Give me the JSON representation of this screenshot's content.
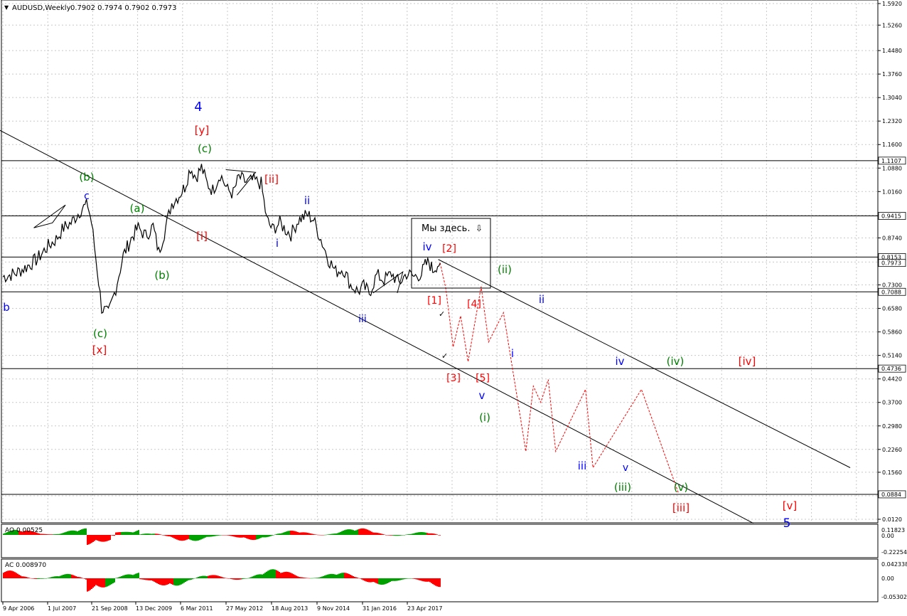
{
  "header": {
    "menu_icon": "triangle-down-icon",
    "symbol": "AUDUSD,Weekly",
    "ohlc": "0.7902 0.7974 0.7902 0.7973"
  },
  "callout": {
    "text": "Мы здесь.",
    "arrow_icon": "arrow-down-outline-icon"
  },
  "colors": {
    "grid": "#c8c8c8",
    "price": "#000000",
    "forecast": "#ff0000",
    "label_blue": "#0000ff",
    "label_red": "#ff0000",
    "label_green": "#008000",
    "ao_up": "#00a000",
    "ao_down": "#ff0000",
    "price_box_bg": "#ffffff",
    "current_price_bg": "#ffffff"
  },
  "chart_data": {
    "type": "line",
    "symbol": "AUDUSD",
    "timeframe": "Weekly",
    "x_ticks": [
      "9 Apr 2006",
      "1 Jul 2007",
      "21 Sep 2008",
      "13 Dec 2009",
      "6 Mar 2011",
      "27 May 2012",
      "18 Aug 2013",
      "9 Nov 2014",
      "31 Jan 2016",
      "23 Apr 2017"
    ],
    "y_ticks": [
      "1.5920",
      "1.5260",
      "1.4480",
      "1.3760",
      "1.3040",
      "1.2320",
      "1.1600",
      "1.0880",
      "1.0160",
      "0.9440",
      "0.8740",
      "0.8000",
      "0.7300",
      "0.6580",
      "0.5860",
      "0.5140",
      "0.4420",
      "0.3700",
      "0.2980",
      "0.2260",
      "0.1560",
      "0.0840",
      "0.0120"
    ],
    "ylim": [
      0.012,
      1.592
    ],
    "horizontal_levels": [
      "1.1107",
      "0.9415",
      "0.8153",
      "0.7088",
      "0.4736",
      "0.0884"
    ],
    "current_price": "0.7973",
    "price_series_weekly_close_sampled": [
      [
        2006.27,
        0.755
      ],
      [
        2006.6,
        0.765
      ],
      [
        2006.9,
        0.785
      ],
      [
        2007.2,
        0.81
      ],
      [
        2007.45,
        0.845
      ],
      [
        2007.7,
        0.87
      ],
      [
        2007.9,
        0.905
      ],
      [
        2008.1,
        0.92
      ],
      [
        2008.4,
        0.965
      ],
      [
        2008.55,
        0.975
      ],
      [
        2008.65,
        0.92
      ],
      [
        2008.8,
        0.78
      ],
      [
        2008.92,
        0.66
      ],
      [
        2009.1,
        0.64
      ],
      [
        2009.3,
        0.72
      ],
      [
        2009.5,
        0.82
      ],
      [
        2009.75,
        0.88
      ],
      [
        2009.9,
        0.905
      ],
      [
        2010.1,
        0.88
      ],
      [
        2010.3,
        0.91
      ],
      [
        2010.45,
        0.83
      ],
      [
        2010.6,
        0.89
      ],
      [
        2010.8,
        0.98
      ],
      [
        2011.0,
        1.005
      ],
      [
        2011.15,
        1.03
      ],
      [
        2011.3,
        1.09
      ],
      [
        2011.45,
        1.06
      ],
      [
        2011.6,
        1.09
      ],
      [
        2011.75,
        1.04
      ],
      [
        2011.9,
        1.02
      ],
      [
        2012.1,
        1.07
      ],
      [
        2012.3,
        1.02
      ],
      [
        2012.45,
        1.01
      ],
      [
        2012.6,
        1.06
      ],
      [
        2012.8,
        1.045
      ],
      [
        2013.0,
        1.05
      ],
      [
        2013.2,
        1.04
      ],
      [
        2013.35,
        0.93
      ],
      [
        2013.5,
        0.9
      ],
      [
        2013.7,
        0.92
      ],
      [
        2013.85,
        0.9
      ],
      [
        2014.0,
        0.885
      ],
      [
        2014.2,
        0.93
      ],
      [
        2014.45,
        0.945
      ],
      [
        2014.6,
        0.93
      ],
      [
        2014.8,
        0.87
      ],
      [
        2015.0,
        0.81
      ],
      [
        2015.2,
        0.77
      ],
      [
        2015.4,
        0.78
      ],
      [
        2015.6,
        0.73
      ],
      [
        2015.8,
        0.71
      ],
      [
        2015.95,
        0.725
      ],
      [
        2016.1,
        0.705
      ],
      [
        2016.3,
        0.76
      ],
      [
        2016.5,
        0.745
      ],
      [
        2016.7,
        0.765
      ],
      [
        2016.9,
        0.735
      ],
      [
        2017.1,
        0.765
      ],
      [
        2017.3,
        0.755
      ],
      [
        2017.5,
        0.765
      ],
      [
        2017.6,
        0.79
      ],
      [
        2017.7,
        0.8
      ],
      [
        2017.8,
        0.775
      ],
      [
        2017.9,
        0.79
      ],
      [
        2018.0,
        0.7973
      ]
    ],
    "forecast_path_red_dashed": [
      [
        2018.0,
        0.7973
      ],
      [
        2018.15,
        0.72
      ],
      [
        2018.35,
        0.54
      ],
      [
        2018.55,
        0.635
      ],
      [
        2018.75,
        0.495
      ],
      [
        2019.1,
        0.725
      ],
      [
        2019.3,
        0.555
      ],
      [
        2019.7,
        0.645
      ],
      [
        2020.3,
        0.22
      ],
      [
        2020.5,
        0.42
      ],
      [
        2020.7,
        0.37
      ],
      [
        2020.9,
        0.44
      ],
      [
        2021.1,
        0.22
      ],
      [
        2021.9,
        0.41
      ],
      [
        2022.1,
        0.17
      ],
      [
        2023.4,
        0.41
      ],
      [
        2024.4,
        0.09
      ]
    ],
    "trendlines": [
      {
        "from": [
          2006.0,
          1.215
        ],
        "to": [
          2026.4,
          0.0
        ]
      },
      {
        "from": [
          2017.95,
          0.808
        ],
        "to": [
          2029.0,
          0.17
        ]
      }
    ],
    "wave_labels": [
      {
        "text": "4",
        "color": "blue"
      },
      {
        "text": "[y]",
        "color": "red"
      },
      {
        "text": "(c)",
        "color": "green"
      },
      {
        "text": "(b)",
        "color": "green"
      },
      {
        "text": "c",
        "color": "blue"
      },
      {
        "text": "(a)",
        "color": "green"
      },
      {
        "text": "[ii]",
        "color": "red"
      },
      {
        "text": "ii",
        "color": "blue"
      },
      {
        "text": "[i]",
        "color": "red"
      },
      {
        "text": "i",
        "color": "blue"
      },
      {
        "text": "b",
        "color": "blue"
      },
      {
        "text": "(b)",
        "color": "green"
      },
      {
        "text": "(c)",
        "color": "green"
      },
      {
        "text": "[x]",
        "color": "red"
      },
      {
        "text": "iii",
        "color": "blue"
      },
      {
        "text": "iv",
        "color": "blue"
      },
      {
        "text": "[2]",
        "color": "red"
      },
      {
        "text": "(ii)",
        "color": "green"
      },
      {
        "text": "[1]",
        "color": "red"
      },
      {
        "text": "[4]",
        "color": "red"
      },
      {
        "text": "ii",
        "color": "blue"
      },
      {
        "text": "i",
        "color": "blue"
      },
      {
        "text": "[3]",
        "color": "red"
      },
      {
        "text": "[5]",
        "color": "red"
      },
      {
        "text": "v",
        "color": "blue"
      },
      {
        "text": "(i)",
        "color": "green"
      },
      {
        "text": "iv",
        "color": "blue"
      },
      {
        "text": "(iv)",
        "color": "green"
      },
      {
        "text": "[iv]",
        "color": "red"
      },
      {
        "text": "iii",
        "color": "blue"
      },
      {
        "text": "v",
        "color": "blue"
      },
      {
        "text": "(iii)",
        "color": "green"
      },
      {
        "text": "(v)",
        "color": "green"
      },
      {
        "text": "[iii]",
        "color": "red"
      },
      {
        "text": "[v]",
        "color": "red"
      },
      {
        "text": "5",
        "color": "blue"
      }
    ],
    "indicators": [
      {
        "name": "AO",
        "label": "AO 0.00525",
        "y_ticks": [
          "0.11823",
          "0.00",
          "-0.22254"
        ]
      },
      {
        "name": "AC",
        "label": "AC 0.008970",
        "y_ticks": [
          "0.042338",
          "0.00",
          "-0.053021"
        ]
      }
    ]
  }
}
